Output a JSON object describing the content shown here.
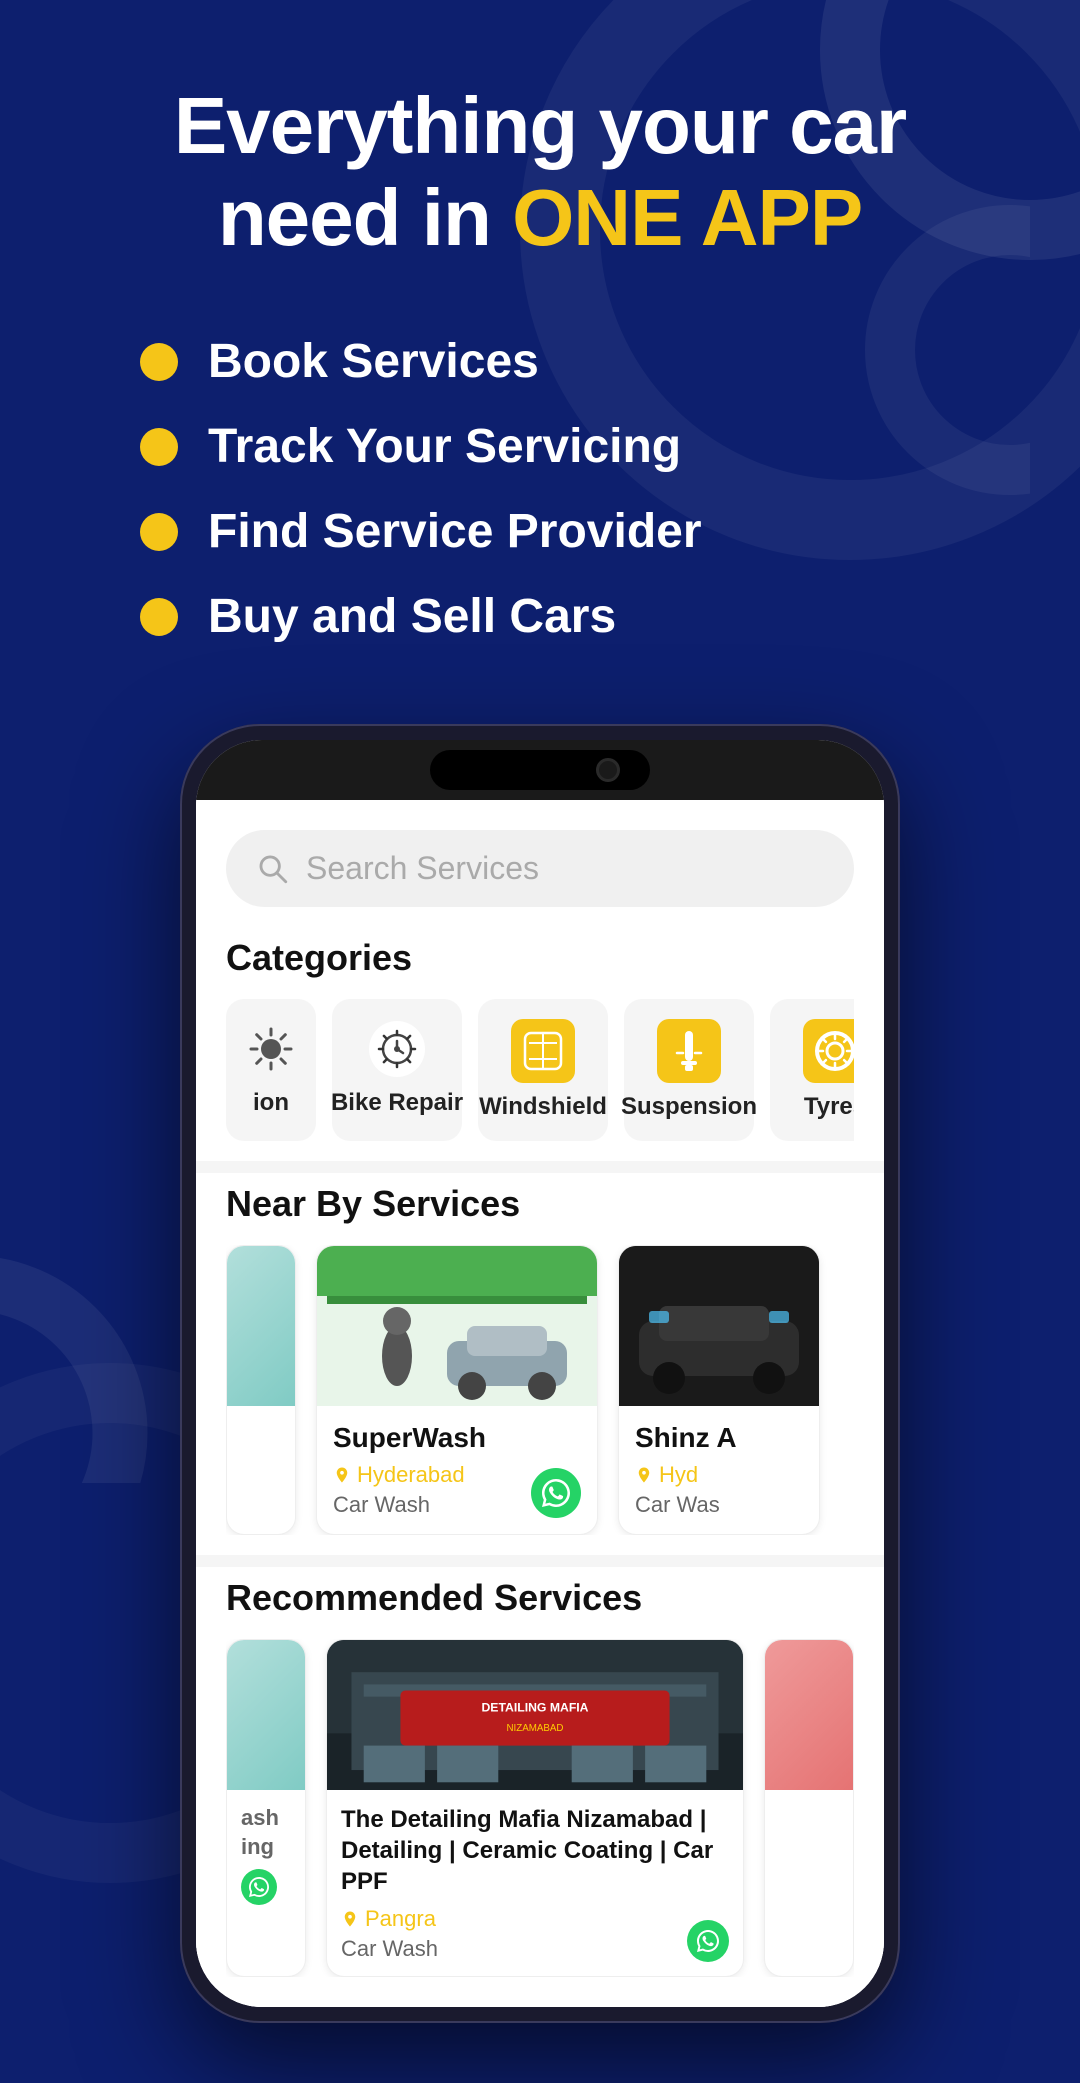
{
  "hero": {
    "title_line1": "Everything your car",
    "title_line2": "need in ",
    "title_highlight": "ONE APP"
  },
  "features": [
    {
      "id": "book",
      "label": "Book Services"
    },
    {
      "id": "track",
      "label": "Track Your Servicing"
    },
    {
      "id": "find",
      "label": "Find Service Provider"
    },
    {
      "id": "buy",
      "label": "Buy and Sell Cars"
    }
  ],
  "phone": {
    "search_placeholder": "Search Services",
    "categories_title": "Categories",
    "categories": [
      {
        "id": "partial",
        "label": "ion",
        "icon": "⚙️",
        "type": "partial"
      },
      {
        "id": "bike-repair",
        "label": "Bike Repair",
        "icon": "gear",
        "type": "gear"
      },
      {
        "id": "windshield",
        "label": "Windshield",
        "icon": "windshield",
        "type": "windshield"
      },
      {
        "id": "suspension",
        "label": "Suspension",
        "icon": "suspension",
        "type": "suspension"
      },
      {
        "id": "tyres",
        "label": "Tyres",
        "icon": "tyres",
        "type": "tyres"
      }
    ],
    "nearby_title": "Near By Services",
    "nearby_services": [
      {
        "id": "superwash",
        "name": "SuperWash",
        "location": "Hyderabad",
        "type": "Car Wash",
        "img_type": "green"
      },
      {
        "id": "shinz",
        "name": "Shinz A",
        "location": "Hyd",
        "type": "Car Was",
        "img_type": "dark"
      }
    ],
    "recommended_title": "Recommended Services",
    "recommended_services": [
      {
        "id": "partial-left",
        "name": "ash\ning",
        "type": "",
        "img_type": "partial"
      },
      {
        "id": "detailing-mafia",
        "name": "The Detailing Mafia Nizamabad | Detailing | Ceramic Coating | Car PPF",
        "location": "Pangra",
        "type": "Car Wash",
        "img_type": "detailing"
      },
      {
        "id": "partial-right",
        "name": "",
        "img_type": "red"
      }
    ]
  },
  "colors": {
    "bg": "#0d1f6e",
    "accent": "#f5c518",
    "white": "#ffffff",
    "card_bg": "#ffffff",
    "search_bg": "#f0f0f0"
  }
}
